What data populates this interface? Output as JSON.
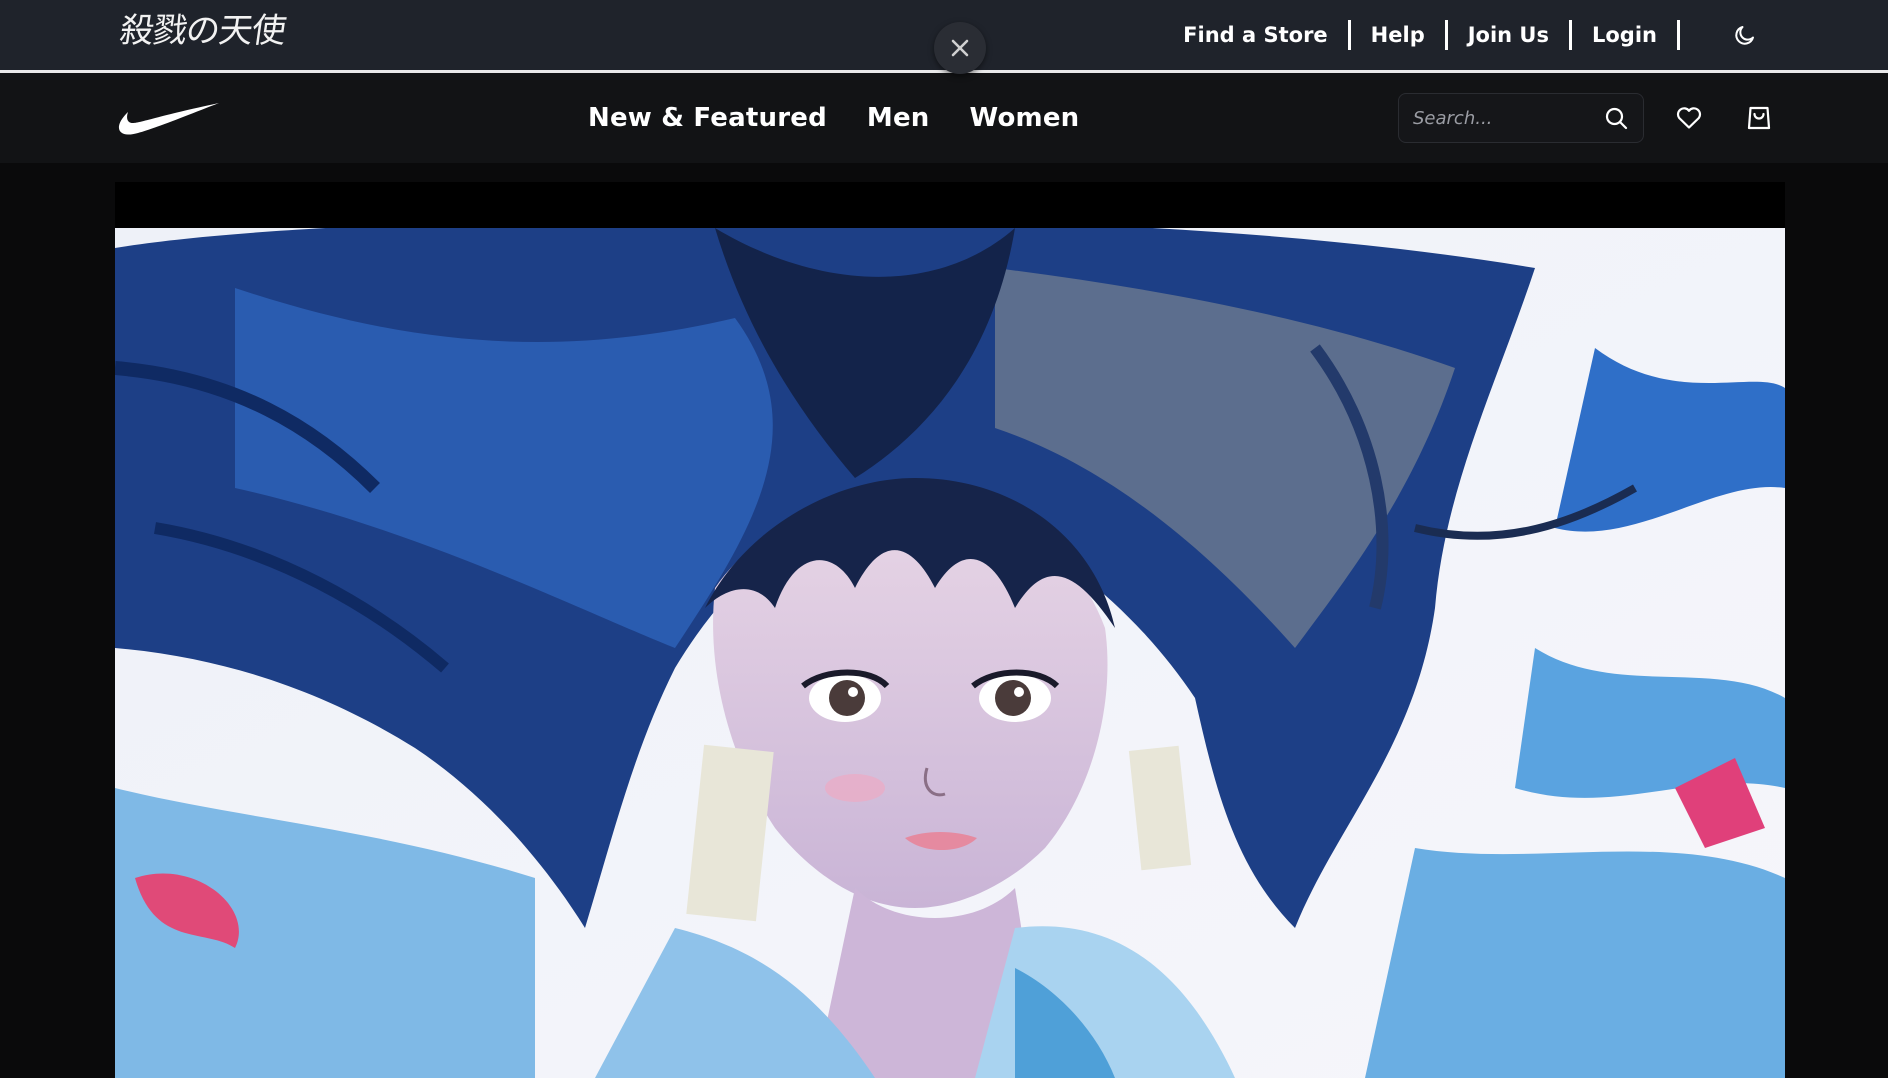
{
  "topbar": {
    "brand_text": "殺戮の天使",
    "links": {
      "find_store": "Find a Store",
      "help": "Help",
      "join": "Join Us",
      "login": "Login"
    },
    "theme_icon": "moon-icon",
    "close_icon": "close-icon"
  },
  "nav": {
    "logo_icon": "swoosh-logo",
    "items": [
      {
        "label": "New & Featured"
      },
      {
        "label": "Men"
      },
      {
        "label": "Women"
      }
    ],
    "search": {
      "placeholder": "Search...",
      "icon": "search-icon"
    },
    "favorites_icon": "heart-icon",
    "bag_icon": "shopping-bag-icon"
  },
  "hero": {
    "image_description_icon": "hero-illustration"
  },
  "colors": {
    "topbar_bg": "#1f232b",
    "nav_bg": "#121315",
    "page_bg": "#0a0a0b",
    "text": "#ffffff",
    "accent_blue": "#2f64b4"
  }
}
